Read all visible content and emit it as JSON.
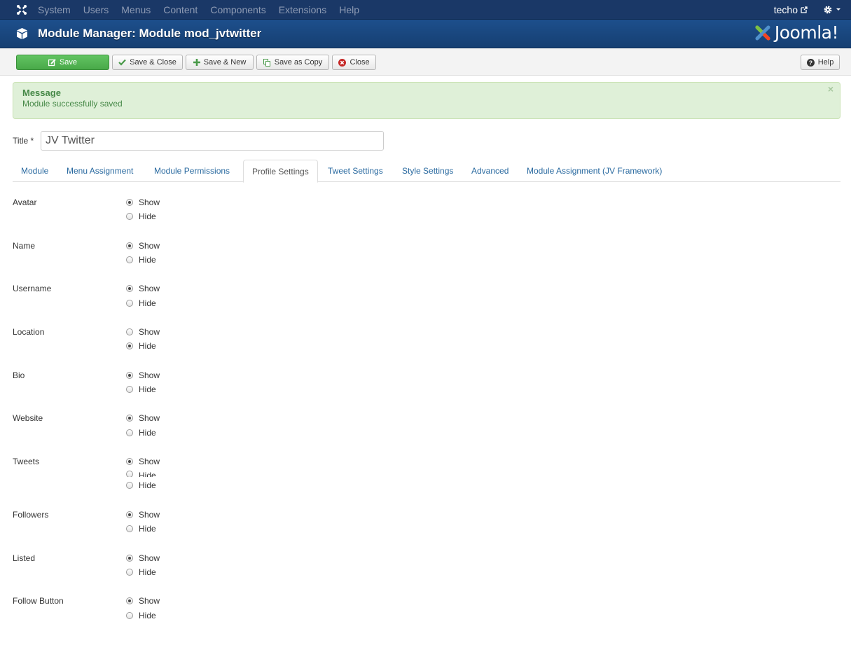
{
  "topnav": {
    "menu": [
      "System",
      "Users",
      "Menus",
      "Content",
      "Components",
      "Extensions",
      "Help"
    ],
    "user": "techo"
  },
  "header": {
    "title": "Module Manager: Module mod_jvtwitter",
    "brand": "Joomla!"
  },
  "toolbar": {
    "save": "Save",
    "save_close": "Save & Close",
    "save_new": "Save & New",
    "save_copy": "Save as Copy",
    "close": "Close",
    "help": "Help"
  },
  "message": {
    "heading": "Message",
    "text": "Module successfully saved",
    "close": "×"
  },
  "title_field": {
    "label": "Title *",
    "value": "JV Twitter"
  },
  "tabs": [
    {
      "label": "Module",
      "active": false
    },
    {
      "label": "Menu Assignment",
      "active": false
    },
    {
      "label": "Module Permissions",
      "active": false
    },
    {
      "label": "Profile Settings",
      "active": true
    },
    {
      "label": "Tweet Settings",
      "active": false
    },
    {
      "label": "Style Settings",
      "active": false
    },
    {
      "label": "Advanced",
      "active": false
    },
    {
      "label": "Module Assignment (JV Framework)",
      "active": false
    }
  ],
  "options": [
    {
      "label": "Avatar",
      "show": "Show",
      "hide": "Hide",
      "selected": "Show"
    },
    {
      "label": "Name",
      "show": "Show",
      "hide": "Hide",
      "selected": "Show"
    },
    {
      "label": "Username",
      "show": "Show",
      "hide": "Hide",
      "selected": "Show"
    },
    {
      "label": "Location",
      "show": "Show",
      "hide": "Hide",
      "selected": "Hide"
    },
    {
      "label": "Bio",
      "show": "Show",
      "hide": "Hide",
      "selected": "Show"
    },
    {
      "label": "Website",
      "show": "Show",
      "hide": "Hide",
      "selected": "Show"
    },
    {
      "label": "Tweets",
      "show": "Show",
      "hide": "Hide",
      "extra": "Hide",
      "selected": "Show"
    },
    {
      "label": "Followers",
      "show": "Show",
      "hide": "Hide",
      "selected": "Show"
    },
    {
      "label": "Listed",
      "show": "Show",
      "hide": "Hide",
      "selected": "Show"
    },
    {
      "label": "Follow Button",
      "show": "Show",
      "hide": "Hide",
      "selected": "Show"
    }
  ],
  "colors": {
    "topnav": "#1a3867",
    "header": "#1d4f8c",
    "save_button": "#5bb75b",
    "message_bg": "#dff0d8",
    "link": "#2a6aa0"
  }
}
